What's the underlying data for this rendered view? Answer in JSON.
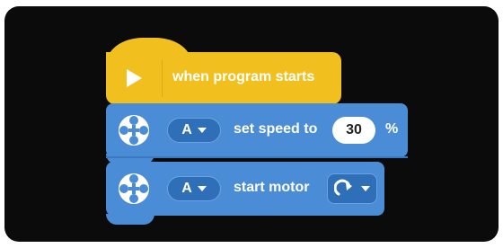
{
  "colors": {
    "canvas": "#0b0b0b",
    "event_block": "#f2c01e",
    "motor_block": "#4a8dd6",
    "pill_dark": "#2f6fb8",
    "text": "#ffffff"
  },
  "hat_block": {
    "icon": "play-icon",
    "label": "when program starts"
  },
  "speed_block": {
    "icon": "motor-icon",
    "port": "A",
    "text": "set speed to",
    "value": "30",
    "unit": "%"
  },
  "start_block": {
    "icon": "motor-icon",
    "port": "A",
    "text": "start motor",
    "direction_icon": "clockwise-arrow-icon"
  }
}
